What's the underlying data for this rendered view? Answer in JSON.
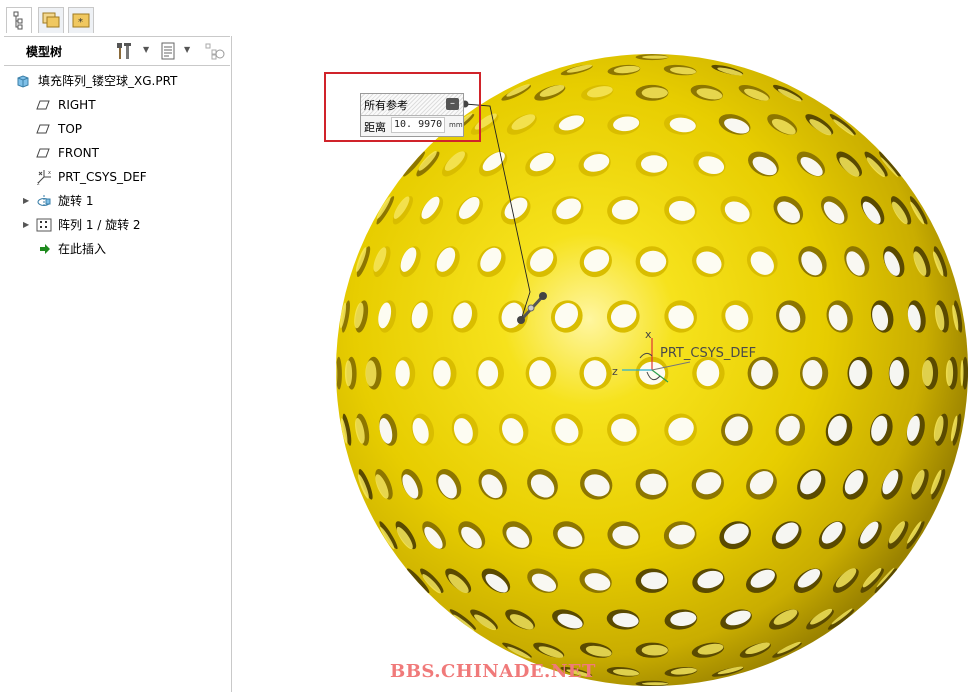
{
  "panel": {
    "tree_title": "模型树",
    "tabs": [
      "model-tree-tab",
      "folder-browser-tab",
      "favorites-tab"
    ]
  },
  "tree": {
    "items": [
      {
        "label": "填充阵列_镂空球_XG.PRT",
        "icon": "part-icon"
      },
      {
        "label": "RIGHT",
        "icon": "datum-plane-icon"
      },
      {
        "label": "TOP",
        "icon": "datum-plane-icon"
      },
      {
        "label": "FRONT",
        "icon": "datum-plane-icon"
      },
      {
        "label": "PRT_CSYS_DEF",
        "icon": "coordinate-system-icon"
      },
      {
        "label": "旋转 1",
        "icon": "revolve-icon"
      },
      {
        "label": "阵列 1 / 旋转 2",
        "icon": "pattern-icon"
      },
      {
        "label": "在此插入",
        "icon": "insert-here-arrow-icon"
      }
    ]
  },
  "ref_popup": {
    "title": "所有参考",
    "distance_label": "距离",
    "distance_value": "10. 9970",
    "unit": "mm"
  },
  "viewport": {
    "csys_label": "PRT_CSYS_DEF",
    "axis_x": "x",
    "axis_z": "z",
    "watermark": "BBS.CHINADE.NET"
  },
  "colors": {
    "sphere_base": "#e8d000",
    "sphere_highlight": "#fff8a0",
    "sphere_shadow": "#a48c00",
    "highlight_box": "#d0232a"
  }
}
